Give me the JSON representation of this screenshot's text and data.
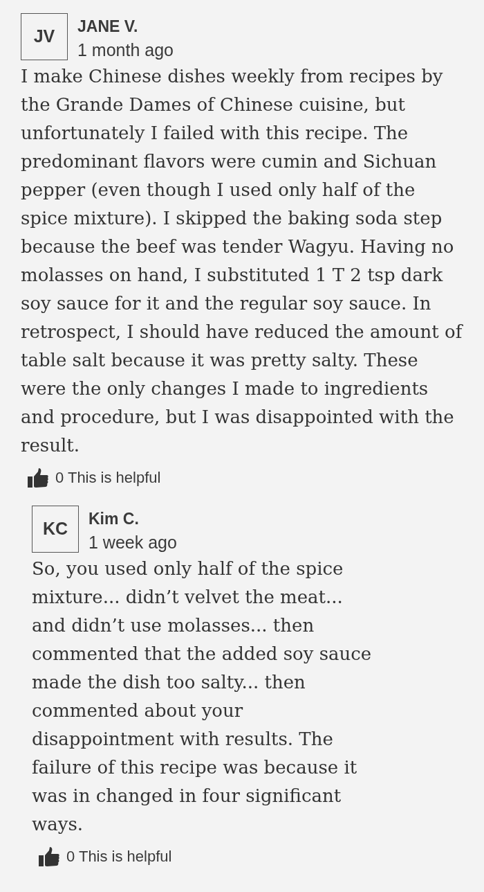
{
  "comments": [
    {
      "initials": "JV",
      "author": "JANE V.",
      "time": "1 month ago",
      "body": "I make Chinese dishes weekly from recipes by the Grande Dames of Chinese cuisine, but unfortunately I failed with this recipe. The predominant flavors were cumin and Sichuan pepper (even though I used only half of the spice mixture). I skipped the baking soda step because the beef was tender Wagyu. Having no molasses on hand, I substituted 1 T 2 tsp dark soy sauce for it and the regular soy sauce. In retrospect, I should have reduced the amount of table salt because it was pretty salty. These were the only changes I made to ingredients and procedure, but I was disappointed with the result.",
      "helpful": "0 This is helpful",
      "replies": [
        {
          "initials": "KC",
          "author": "Kim C.",
          "time": "1 week ago",
          "body": "So, you used only half of the spice mixture... didn’t velvet the meat... and didn’t use molasses... then commented that the added soy sauce made the dish too salty... then commented about your disappointment with results. The failure of this recipe was because it was in changed in four significant ways.",
          "helpful": "0 This is helpful"
        }
      ]
    }
  ]
}
